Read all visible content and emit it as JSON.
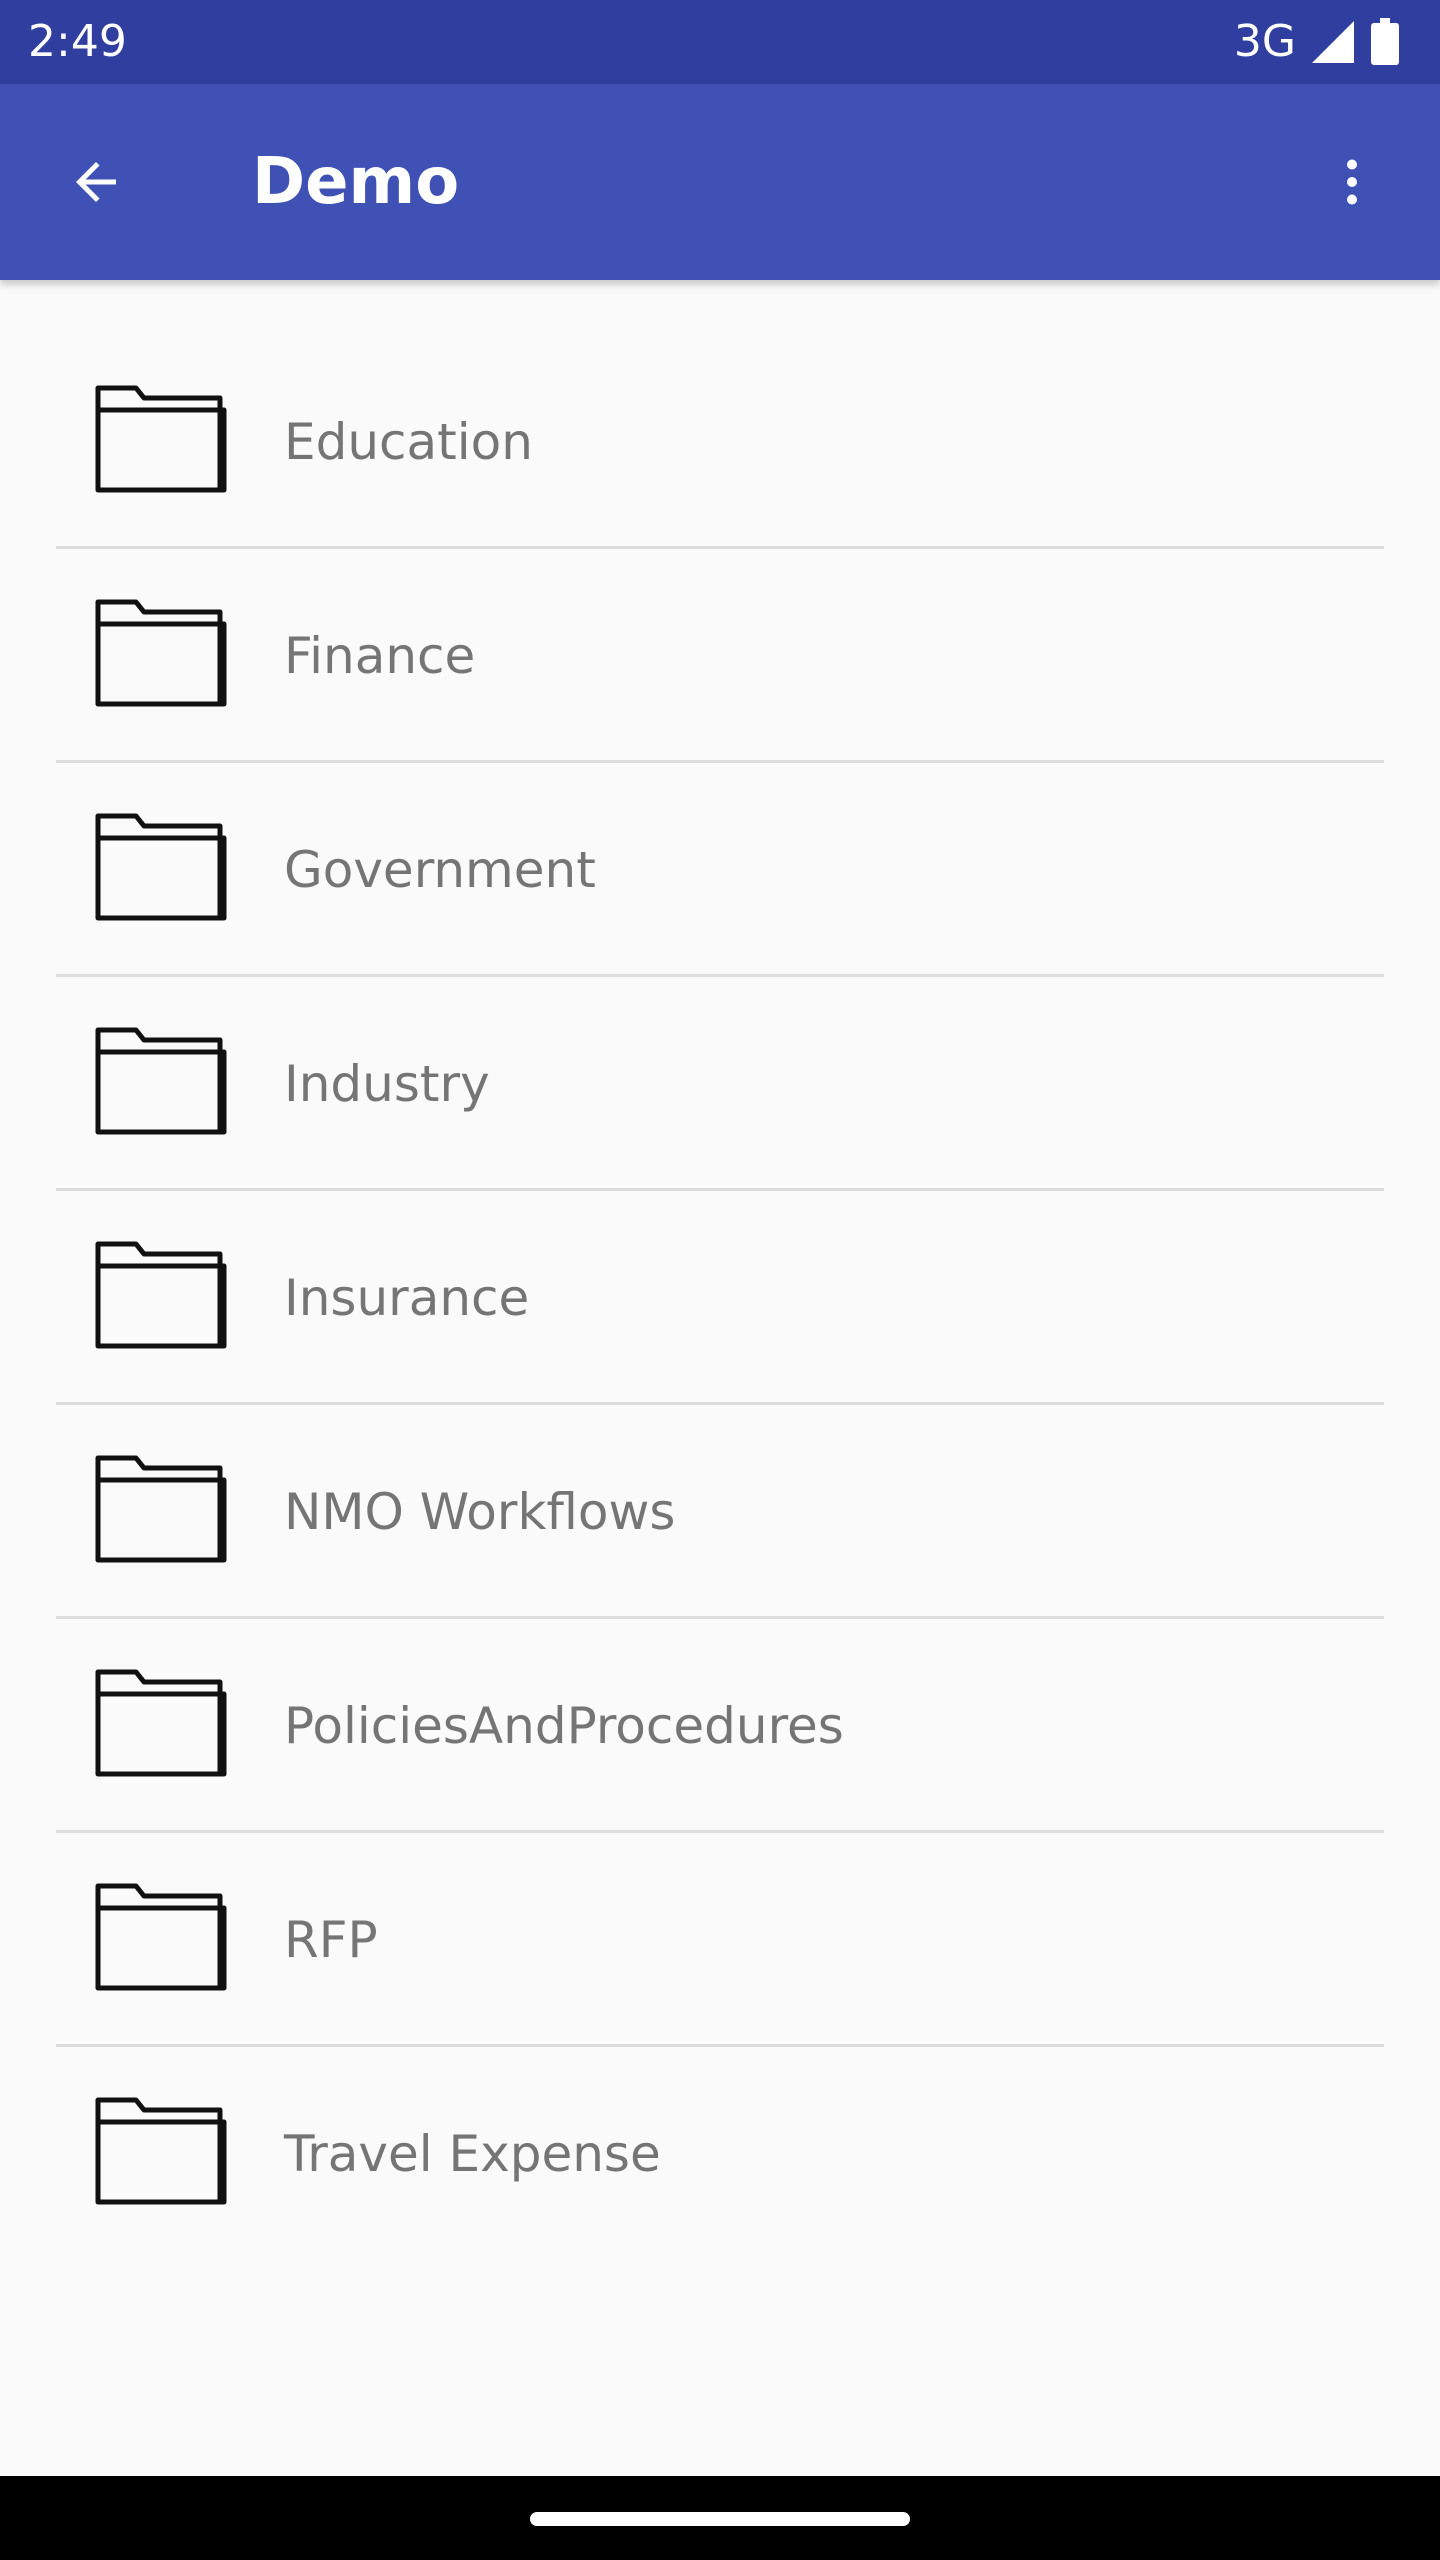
{
  "status_bar": {
    "time": "2:49",
    "network": "3G",
    "signal_icon": "cell-signal-icon",
    "battery_icon": "battery-icon"
  },
  "app_bar": {
    "title": "Demo",
    "back_icon": "arrow-back-icon",
    "menu_icon": "more-vert-icon"
  },
  "folders": [
    {
      "label": "Education"
    },
    {
      "label": "Finance"
    },
    {
      "label": "Government"
    },
    {
      "label": "Industry"
    },
    {
      "label": "Insurance"
    },
    {
      "label": "NMO Workflows"
    },
    {
      "label": "PoliciesAndProcedures"
    },
    {
      "label": "RFP"
    },
    {
      "label": "Travel Expense"
    }
  ],
  "colors": {
    "status_bar": "#303f9f",
    "app_bar": "#3f51b5",
    "background": "#fafafa",
    "label": "#757575",
    "divider": "#dcdcdc"
  }
}
